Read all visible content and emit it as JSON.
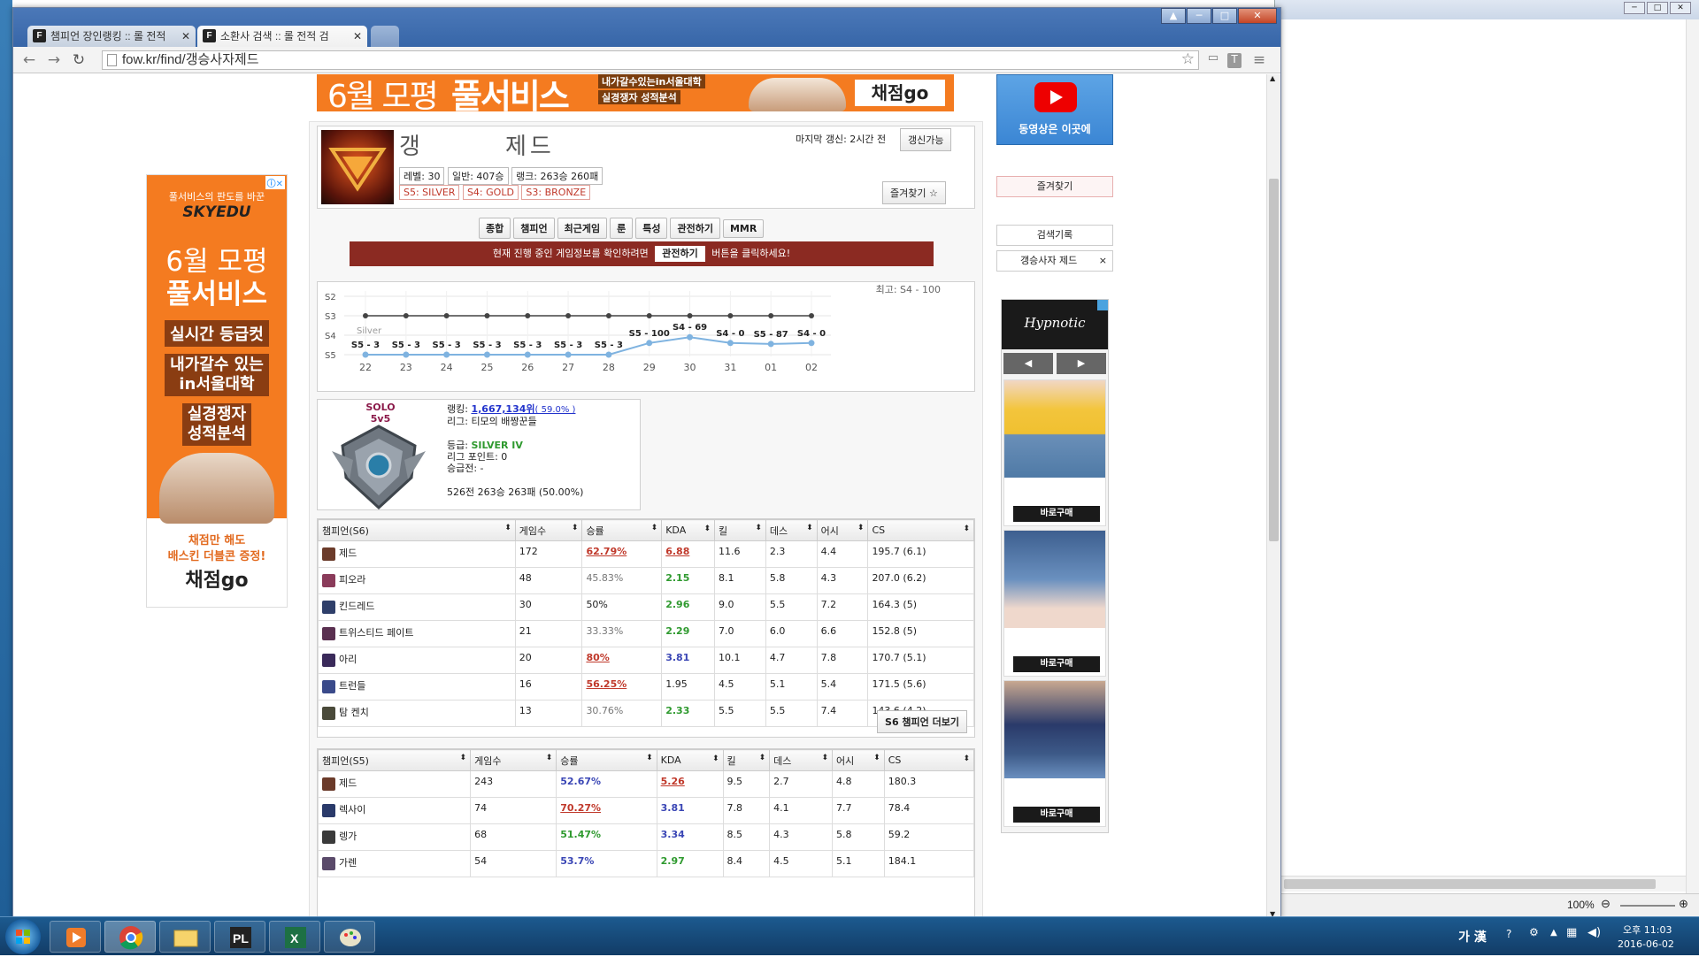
{
  "browser": {
    "tabs": [
      {
        "label": "챔피언 장인랭킹 :: 롤 전적",
        "favicon": "F"
      },
      {
        "label": "소환사 검색 :: 롤 전적 검",
        "favicon": "F"
      }
    ],
    "url": "fow.kr/find/갱승사자제드"
  },
  "top_banner": {
    "headline1": "6월 모평",
    "headline2": "풀서비스",
    "sub1": "내가갈수있는in서울대학",
    "sub2": "실경쟁자 성적분석",
    "brand": "채점go"
  },
  "left_ad": {
    "brand_line": "풀서비스의 판도를 바꾼",
    "brand": "SKYEDU",
    "title1": "6월 모평",
    "title2": "풀서비스",
    "item1": "실시간 등급컷",
    "item2": "내가갈수 있는\nin서울대학",
    "item3": "실경쟁자\n성적분석",
    "promo1": "채점만 해도",
    "promo2": "배스킨 더블콘 증정!",
    "promo_brand": "채점go"
  },
  "summoner": {
    "name_first": "갱",
    "name_last": "제드",
    "last_update": "마지막 갱신: 2시간 전",
    "refresh_button": "갱신가능",
    "level": "레벨: 30",
    "normal": "일반: 407승",
    "ranked": "랭크: 263승 260패",
    "season_tags": [
      "S5: SILVER",
      "S4: GOLD",
      "S3: BRONZE"
    ],
    "favorite_button": "즐겨찾기 ☆"
  },
  "menu": [
    "종합",
    "챔피언",
    "최근게임",
    "룬",
    "특성",
    "관전하기",
    "MMR"
  ],
  "spectate_notice": {
    "before": "현재 진행 중인 게임정보를 확인하려면",
    "button": "관전하기",
    "after": "버튼을 클릭하세요!"
  },
  "chart_data": {
    "type": "line",
    "title": "최고: S4 - 100",
    "y_ticks": [
      "S2",
      "S3",
      "S4",
      "S5"
    ],
    "tier_band_label": "Silver",
    "categories": [
      "22",
      "23",
      "24",
      "25",
      "26",
      "27",
      "28",
      "29",
      "30",
      "31",
      "01",
      "02"
    ],
    "series": [
      {
        "values": [
          3,
          3,
          3,
          3,
          3,
          3,
          3,
          100,
          69,
          0,
          87,
          0
        ],
        "tier_values": [
          5,
          5,
          5,
          5,
          5,
          5,
          5,
          4.4,
          4.1,
          4.4,
          4.45,
          4.4
        ],
        "labels": [
          "S5 - 3",
          "S5 - 3",
          "S5 - 3",
          "S5 - 3",
          "S5 - 3",
          "S5 - 3",
          "S5 - 3",
          "S5 - 100",
          "S4 - 69",
          "S4 - 0",
          "S5 - 87",
          "S4 - 0"
        ]
      }
    ],
    "colors": {
      "line": "#7fb3e0",
      "silver_line": "#444444"
    }
  },
  "solo_rank": {
    "queue": "SOLO\n5v5",
    "ranking_label": "랭킹: ",
    "ranking_value": "1,667,134위",
    "ranking_pct": "( 59.0% )",
    "league": "리그: 티모의 배짱꾼들",
    "tier_label": "등급: ",
    "tier": "SILVER IV",
    "league_points": "리그 포인트: 0",
    "promo": "승급전: -",
    "record": "526전 263승 263패 (50.00%)"
  },
  "s6_table": {
    "headers": [
      "챔피언(S6)",
      "게임수",
      "승률",
      "KDA",
      "킬",
      "데스",
      "어시",
      "CS"
    ],
    "rows": [
      {
        "name": "제드",
        "games": "172",
        "winrate": "62.79%",
        "wr_style": "red",
        "kda": "6.88",
        "kda_style": "red",
        "k": "11.6",
        "d": "2.3",
        "a": "4.4",
        "cs": "195.7 (6.1)",
        "icon": "#6b3b2a"
      },
      {
        "name": "피오라",
        "games": "48",
        "winrate": "45.83%",
        "wr_style": "gray",
        "kda": "2.15",
        "kda_style": "green",
        "k": "8.1",
        "d": "5.8",
        "a": "4.3",
        "cs": "207.0 (6.2)",
        "icon": "#8a3b5a"
      },
      {
        "name": "킨드레드",
        "games": "30",
        "winrate": "50%",
        "wr_style": "plain",
        "kda": "2.96",
        "kda_style": "green",
        "k": "9.0",
        "d": "5.5",
        "a": "7.2",
        "cs": "164.3 (5)",
        "icon": "#2f3f6a"
      },
      {
        "name": "트위스티드 페이트",
        "games": "21",
        "winrate": "33.33%",
        "wr_style": "gray",
        "kda": "2.29",
        "kda_style": "green",
        "k": "7.0",
        "d": "6.0",
        "a": "6.6",
        "cs": "152.8 (5)",
        "icon": "#5a3050"
      },
      {
        "name": "아리",
        "games": "20",
        "winrate": "80%",
        "wr_style": "red",
        "kda": "3.81",
        "kda_style": "blue",
        "k": "10.1",
        "d": "4.7",
        "a": "7.8",
        "cs": "170.7 (5.1)",
        "icon": "#3a2a5a"
      },
      {
        "name": "트런들",
        "games": "16",
        "winrate": "56.25%",
        "wr_style": "red",
        "kda": "1.95",
        "kda_style": "plain",
        "k": "4.5",
        "d": "5.1",
        "a": "5.4",
        "cs": "171.5 (5.6)",
        "icon": "#3a4a8a"
      },
      {
        "name": "탐 켄치",
        "games": "13",
        "winrate": "30.76%",
        "wr_style": "gray",
        "kda": "2.33",
        "kda_style": "green",
        "k": "5.5",
        "d": "5.5",
        "a": "7.4",
        "cs": "143.6 (4.2)",
        "icon": "#4a4a3a"
      }
    ],
    "more_button": "S6 챔피언 더보기"
  },
  "s5_table": {
    "headers": [
      "챔피언(S5)",
      "게임수",
      "승률",
      "KDA",
      "킬",
      "데스",
      "어시",
      "CS"
    ],
    "rows": [
      {
        "name": "제드",
        "games": "243",
        "winrate": "52.67%",
        "wr_style": "blue",
        "kda": "5.26",
        "kda_style": "red",
        "k": "9.5",
        "d": "2.7",
        "a": "4.8",
        "cs": "180.3",
        "icon": "#6b3b2a"
      },
      {
        "name": "렉사이",
        "games": "74",
        "winrate": "70.27%",
        "wr_style": "red",
        "kda": "3.81",
        "kda_style": "blue",
        "k": "7.8",
        "d": "4.1",
        "a": "7.7",
        "cs": "78.4",
        "icon": "#2a3a6a"
      },
      {
        "name": "렝가",
        "games": "68",
        "winrate": "51.47%",
        "wr_style": "green",
        "kda": "3.34",
        "kda_style": "blue",
        "k": "8.5",
        "d": "4.3",
        "a": "5.8",
        "cs": "59.2",
        "icon": "#3a3a3a"
      },
      {
        "name": "가렌",
        "games": "54",
        "winrate": "53.7%",
        "wr_style": "blue",
        "kda": "2.97",
        "kda_style": "green",
        "k": "8.4",
        "d": "4.5",
        "a": "5.1",
        "cs": "184.1",
        "icon": "#5a4a6a"
      }
    ]
  },
  "right_sidebar": {
    "video_label": "동영상은 이곳에",
    "favorites_label": "즐겨찾기",
    "history_label": "검색기록",
    "history_item": "갱승사자 제드",
    "ad_brand": "Hypnotic",
    "buy_label": "바로구매"
  },
  "bg_window": {
    "zoom": "100%"
  },
  "taskbar": {
    "ime": "가 漢",
    "time": "오후 11:03",
    "date": "2016-06-02"
  }
}
